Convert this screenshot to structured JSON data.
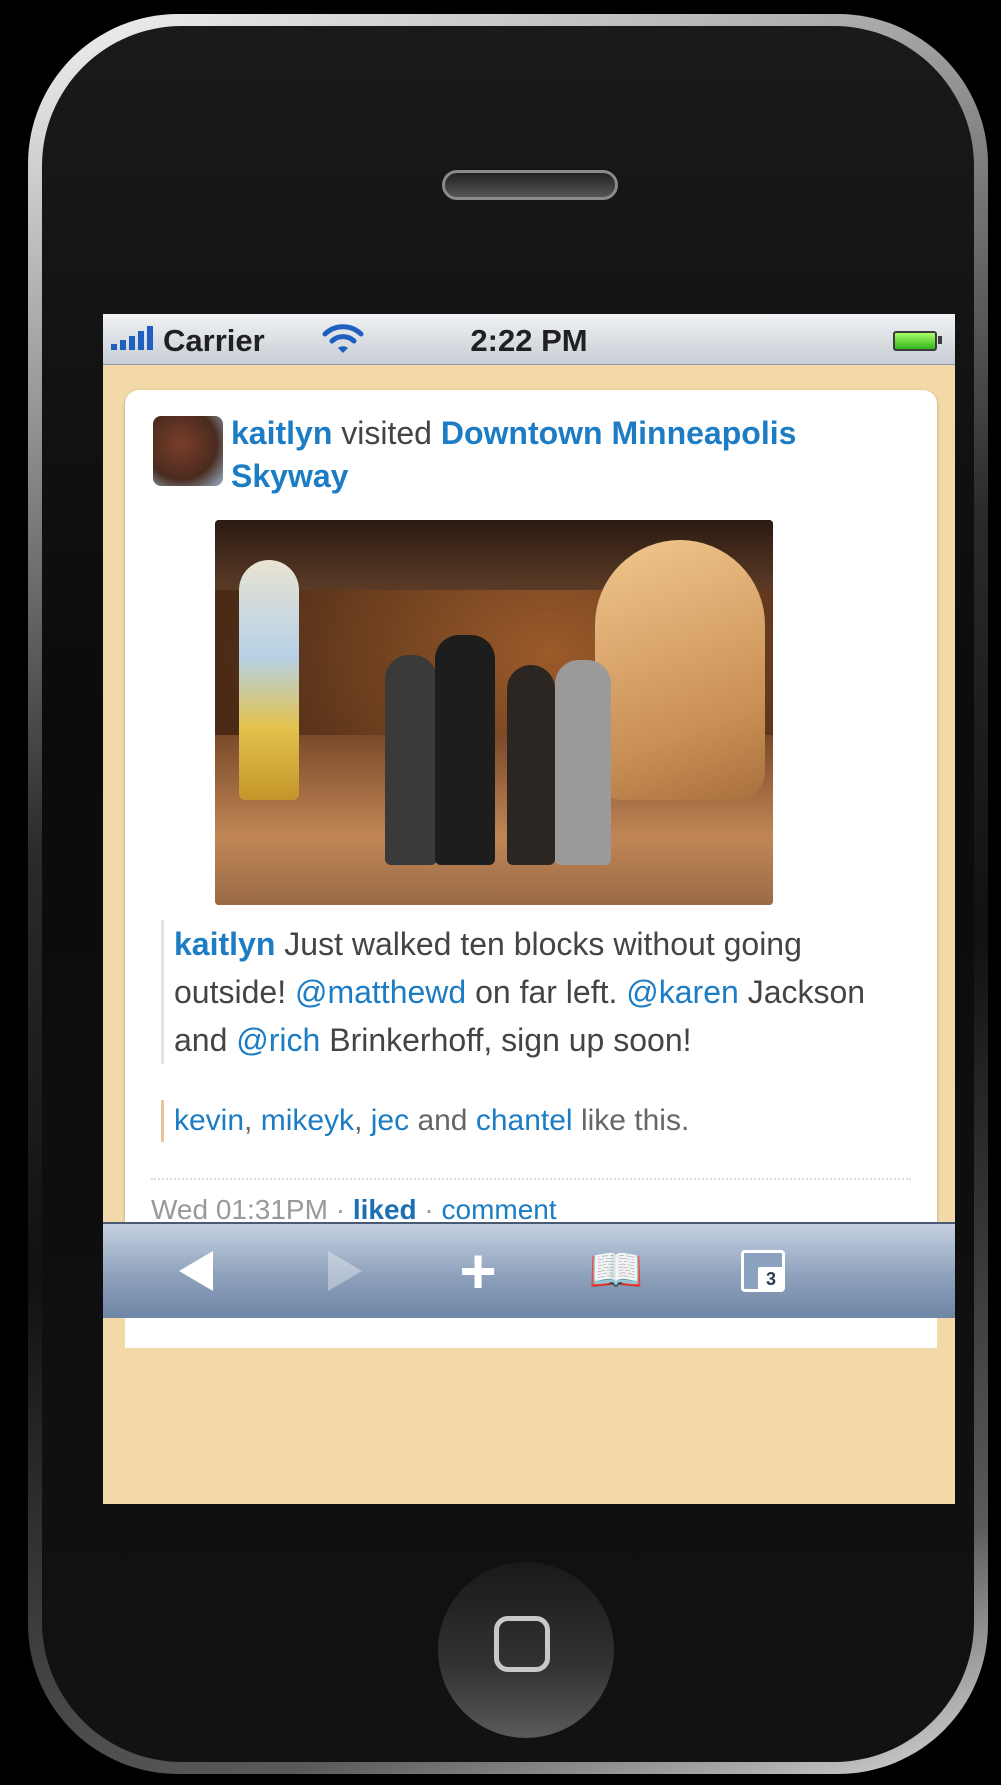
{
  "statusbar": {
    "carrier": "Carrier",
    "time": "2:22 PM",
    "signal_icon": "signal-bars-icon",
    "wifi_icon": "wifi-icon",
    "battery_icon": "battery-icon"
  },
  "feed": {
    "item": {
      "actor": "kaitlyn",
      "verb": "visited",
      "place": "Downtown Minneapolis Skyway",
      "comment_author": "kaitlyn",
      "comment_text_1": "Just walked ten blocks without going outside!",
      "mention_1": "@matthewd",
      "comment_text_2": "on far left.",
      "mention_2": "@karen",
      "comment_text_3": "Jackson and",
      "mention_3": "@rich",
      "comment_text_4": "Brinkerhoff, sign up soon!",
      "likers": [
        "kevin",
        "mikeyk",
        "jec",
        "chantel"
      ],
      "likes_and": "and",
      "likes_suffix": "like this.",
      "timestamp": "Wed 01:31PM",
      "liked_label": "liked",
      "comment_label": "comment",
      "separator": "·"
    }
  },
  "toolbar": {
    "back_icon": "back-arrow-icon",
    "forward_icon": "forward-arrow-icon",
    "add_icon": "plus-icon",
    "bookmarks_icon": "bookmarks-book-icon",
    "pages_icon": "pages-icon",
    "pages_count": "3"
  },
  "colors": {
    "link_blue": "#1c7cc4",
    "background_tan": "#f4d9a8"
  }
}
